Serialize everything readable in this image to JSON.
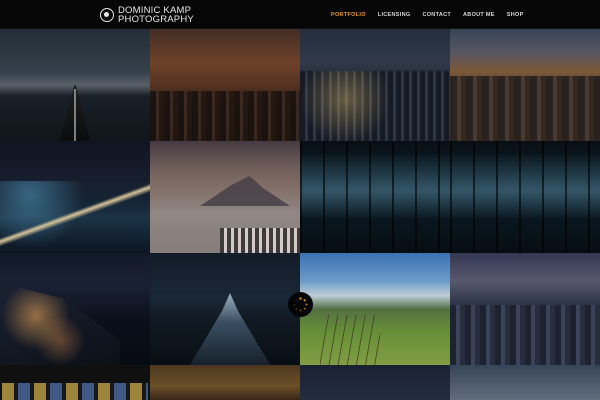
{
  "header": {
    "logo_line1": "DOMINIC KAMP",
    "logo_line2": "PHOTOGRAPHY",
    "nav": [
      {
        "label": "PORTFOLIO",
        "active": true
      },
      {
        "label": "LICENSING",
        "active": false
      },
      {
        "label": "CONTACT",
        "active": false
      },
      {
        "label": "ABOUT ME",
        "active": false
      },
      {
        "label": "SHOP",
        "active": false
      }
    ]
  },
  "colors": {
    "accent": "#e59a2a",
    "background": "#000000",
    "nav_text": "#d8d8d8"
  },
  "icons": {
    "logo": "aperture-circle-icon",
    "loader": "spinner-icon"
  }
}
